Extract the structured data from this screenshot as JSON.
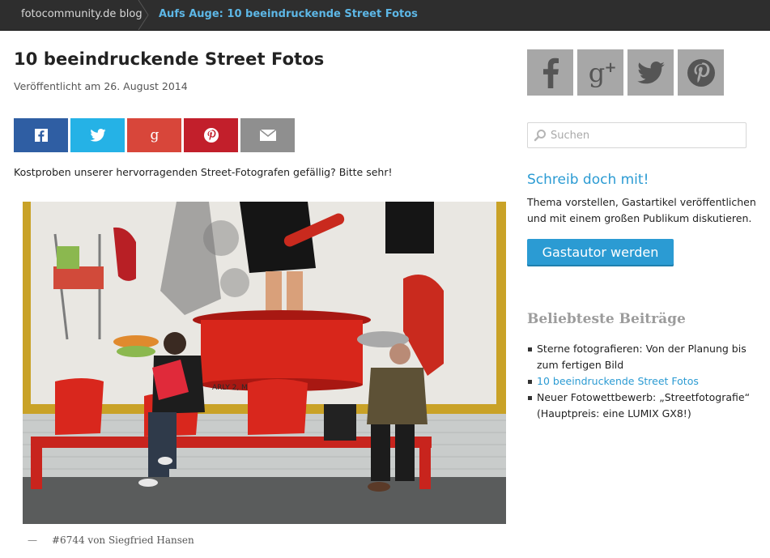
{
  "breadcrumb": {
    "home": "fotocommunity.de blog",
    "current": "Aufs Auge: 10 beeindruckende Street Fotos"
  },
  "post": {
    "title": "10 beeindruckende Street Fotos",
    "date": "Veröffentlicht am 26. August 2014",
    "intro": "Kostproben unserer hervorragenden Street-Fotografen gefällig? Bitte sehr!",
    "caption_dash": "—",
    "caption": "#6744 von Siegfried Hansen",
    "photo_text": "ARLY 2, MONTLHE"
  },
  "share_buttons": [
    {
      "icon": "facebook-icon",
      "color": "#2f5ea3"
    },
    {
      "icon": "twitter-icon",
      "color": "#25b2e6"
    },
    {
      "icon": "google-plus-icon",
      "color": "#d8463a"
    },
    {
      "icon": "pinterest-icon",
      "color": "#c21f2b"
    },
    {
      "icon": "mail-icon",
      "color": "#8f8f8f"
    }
  ],
  "sidebar": {
    "social": [
      {
        "icon": "facebook-icon"
      },
      {
        "icon": "google-plus-icon"
      },
      {
        "icon": "twitter-icon"
      },
      {
        "icon": "pinterest-icon"
      }
    ],
    "search_placeholder": "Suchen",
    "cta": {
      "title": "Schreib doch mit!",
      "text": "Thema vorstellen, Gastartikel veröffentlichen und mit einem großen Publikum diskutieren.",
      "button": "Gastautor werden"
    },
    "popular": {
      "title": "Beliebteste Beiträge",
      "items": [
        {
          "label": "Sterne fotografieren: Von der Planung bis zum fertigen Bild",
          "active": false
        },
        {
          "label": "10 beeindruckende Street Fotos",
          "active": true
        },
        {
          "label": "Neuer Fotowettbewerb: „Streetfotografie“ (Hauptpreis: eine LUMIX GX8!)",
          "active": false
        }
      ]
    }
  },
  "colors": {
    "accent": "#2b9bd3",
    "topbar": "#2e2e2e",
    "social_grey": "#a7a7a7"
  }
}
